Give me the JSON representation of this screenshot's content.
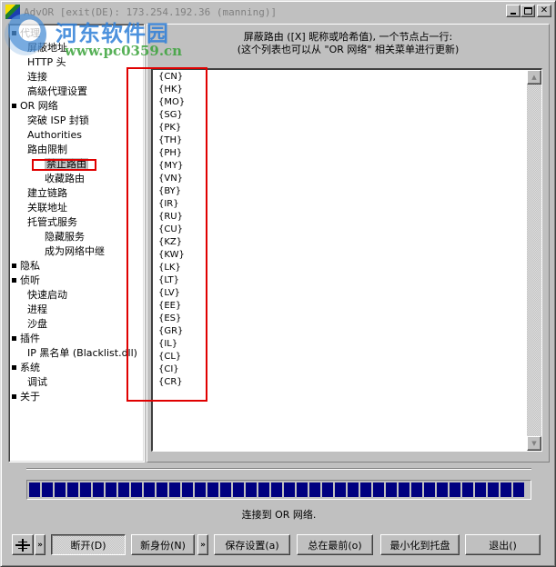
{
  "window": {
    "title": "AdvOR [exit(DE): 173.254.192.36 (manning)]",
    "controls": {
      "minimize": "_",
      "maximize": "□",
      "close": "✕"
    }
  },
  "watermark": {
    "brand": "河东软件园",
    "url": "www.pc0359.cn"
  },
  "tree": {
    "items": [
      {
        "label": "代理",
        "level": 0,
        "bullet": true
      },
      {
        "label": "屏蔽地址",
        "level": 1
      },
      {
        "label": "HTTP 头",
        "level": 1
      },
      {
        "label": "连接",
        "level": 1
      },
      {
        "label": "高级代理设置",
        "level": 1
      },
      {
        "label": "OR 网络",
        "level": 0,
        "bullet": true
      },
      {
        "label": "突破 ISP 封锁",
        "level": 1
      },
      {
        "label": "Authorities",
        "level": 1
      },
      {
        "label": "路由限制",
        "level": 1
      },
      {
        "label": "禁止路由",
        "level": 2,
        "selected": true
      },
      {
        "label": "收藏路由",
        "level": 2
      },
      {
        "label": "建立链路",
        "level": 1
      },
      {
        "label": "关联地址",
        "level": 1
      },
      {
        "label": "托管式服务",
        "level": 1
      },
      {
        "label": "隐藏服务",
        "level": 2
      },
      {
        "label": "成为网络中继",
        "level": 2
      },
      {
        "label": "隐私",
        "level": 0,
        "bullet": true
      },
      {
        "label": "侦听",
        "level": 0,
        "bullet": true
      },
      {
        "label": "快速启动",
        "level": 1
      },
      {
        "label": "进程",
        "level": 1
      },
      {
        "label": "沙盘",
        "level": 1
      },
      {
        "label": "插件",
        "level": 0,
        "bullet": true
      },
      {
        "label": "IP 黑名单 (Blacklist.dll)",
        "level": 1
      },
      {
        "label": "系统",
        "level": 0,
        "bullet": true
      },
      {
        "label": "调试",
        "level": 1
      },
      {
        "label": "关于",
        "level": 0,
        "bullet": true
      }
    ]
  },
  "panel": {
    "header_line1": "屏蔽路由 ([X] 昵称或哈希值), 一个节点占一行:",
    "header_line2": "(这个列表也可以从 \"OR 网络\" 相关菜单进行更新)",
    "banned_routes": [
      "{CN}",
      "{HK}",
      "{MO}",
      "{SG}",
      "{PK}",
      "{TH}",
      "{PH}",
      "{MY}",
      "{VN}",
      "{BY}",
      "{IR}",
      "{RU}",
      "{CU}",
      "{KZ}",
      "{KW}",
      "{LK}",
      "{LT}",
      "{LV}",
      "{EE}",
      "{ES}",
      "{GR}",
      "{IL}",
      "{CL}",
      "{CI}",
      "{CR}"
    ]
  },
  "scrollbar": {
    "up": "▲",
    "down": "▼"
  },
  "progress": {
    "percent": 100,
    "color": "#000080"
  },
  "status": {
    "text": "连接到 OR 网络."
  },
  "buttons": {
    "network_menu": "network-icon",
    "more1": "»",
    "disconnect": "断开(D)",
    "new_identity": "新身份(N)",
    "more2": "»",
    "save_settings": "保存设置(a)",
    "always_on_top": "总在最前(o)",
    "minimize_to_tray": "最小化到托盘",
    "exit": "退出()"
  },
  "annotation": {
    "color": "#e00000"
  }
}
